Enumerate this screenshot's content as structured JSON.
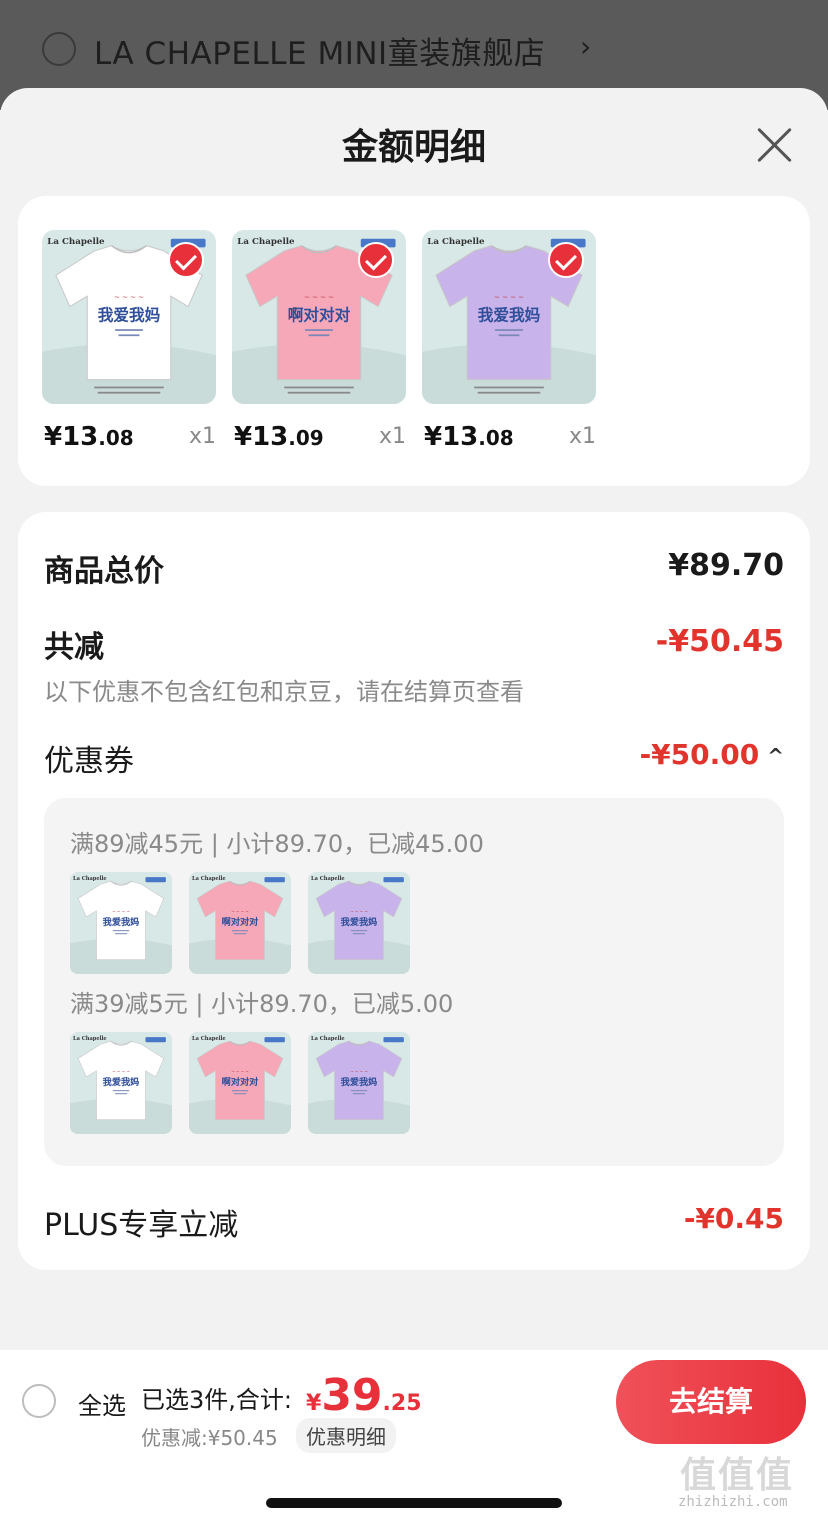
{
  "store": {
    "name": "LA CHAPELLE MINI童装旗舰店",
    "chevron": "›"
  },
  "sheet": {
    "title": "金额明细"
  },
  "products": [
    {
      "brand": "La Chapelle",
      "print": "我爱我妈",
      "price_int": "¥13",
      "price_dec": ".08",
      "qty": "x1",
      "color": "#ffffff",
      "checked": true
    },
    {
      "brand": "La Chapelle",
      "print": "啊对对对",
      "price_int": "¥13",
      "price_dec": ".09",
      "qty": "x1",
      "color": "#f6a7b8",
      "checked": true
    },
    {
      "brand": "La Chapelle",
      "print": "我爱我妈",
      "price_int": "¥13",
      "price_dec": ".08",
      "qty": "x1",
      "color": "#c8b3ea",
      "checked": true
    }
  ],
  "summary": {
    "total_label": "商品总价",
    "total_value": "¥89.70",
    "reduce_label": "共减",
    "reduce_value": "-¥50.45",
    "note": "以下优惠不包含红包和京豆，请在结算页查看",
    "coupon_label": "优惠券",
    "coupon_value": "-¥50.00",
    "coupon_caret": "^",
    "plus_label": "PLUS专享立减",
    "plus_value": "-¥0.45"
  },
  "coupon_tiers": [
    {
      "label": "满89减45元 | 小计89.70，已减45.00"
    },
    {
      "label": "满39减5元 | 小计89.70，已减5.00"
    }
  ],
  "bottom": {
    "select_all": "全选",
    "selected_text": "已选3件,合计:",
    "total_sym": "¥",
    "total_int": "39",
    "total_dec": ".25",
    "discount_text": "优惠减:¥50.45",
    "detail_link": "优惠明细",
    "checkout": "去结算"
  },
  "watermark": {
    "text": "zhizhizhi.com",
    "logo": "值值值"
  },
  "colors": {
    "accent": "#e8303a",
    "discount_red": "#e0342c"
  }
}
